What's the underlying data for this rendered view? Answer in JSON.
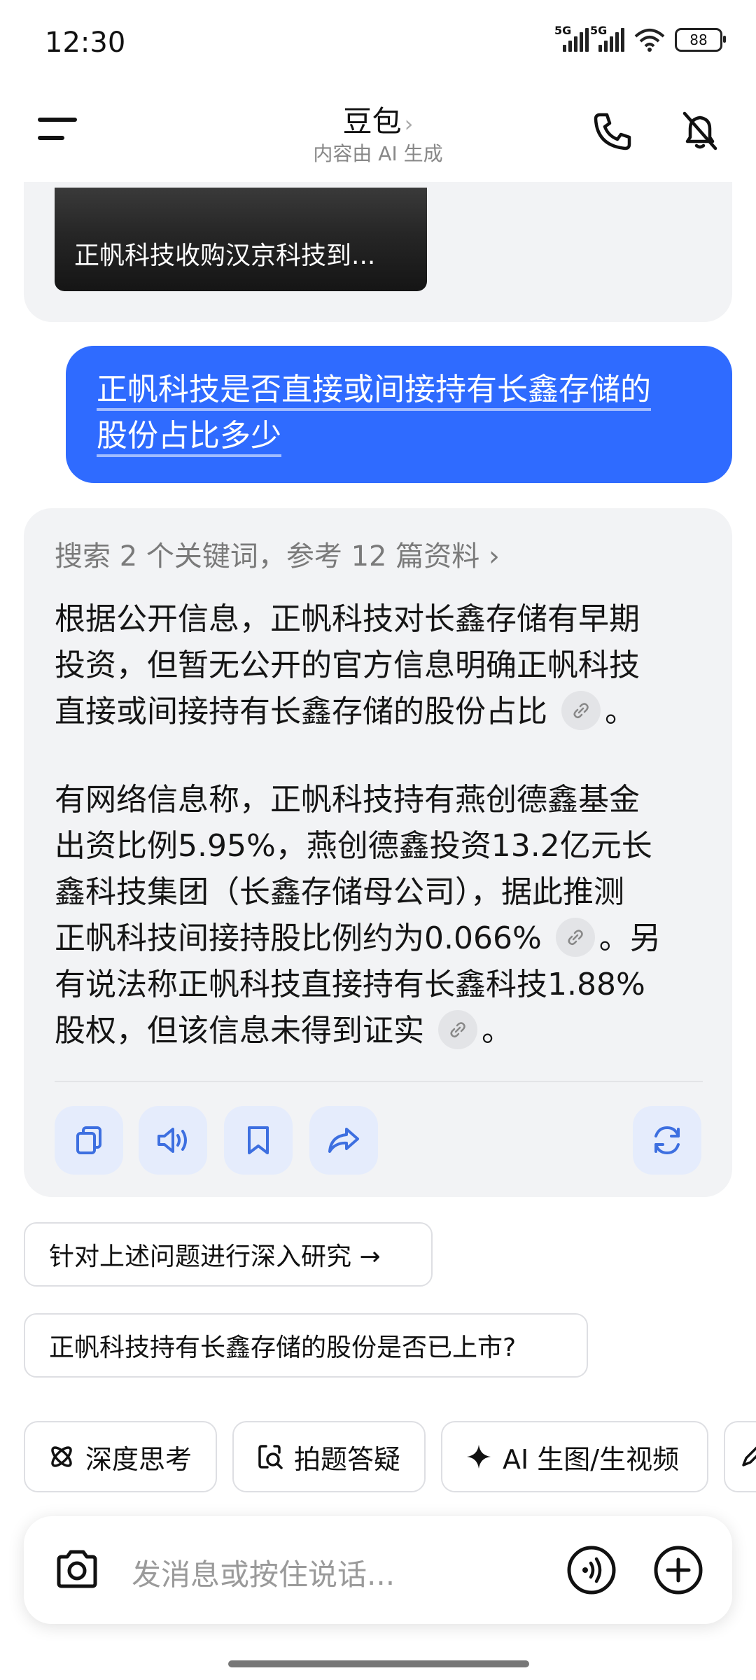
{
  "status_bar": {
    "time": "12:30",
    "network_1": "5G",
    "network_2": "5G",
    "battery": "88"
  },
  "header": {
    "title": "豆包",
    "title_chevron": "›",
    "subtitle": "内容由 AI 生成",
    "icons": [
      "menu-icon",
      "phone-icon",
      "mute-icon"
    ]
  },
  "previous_card": {
    "image_caption": "正帆科技收购汉京科技到..."
  },
  "user_message": {
    "line1": "正帆科技是否直接或间接持有长鑫存储的",
    "line2": "股份占比多少"
  },
  "answer": {
    "search_summary": "搜索 2 个关键词，参考 12 篇资料 ›",
    "para1": {
      "line1": "根据公开信息，正帆科技对长鑫存储有早期",
      "line2": "投资，但暂无公开的官方信息明确正帆科技",
      "line3": "直接或间接持有长鑫存储的股份占比",
      "line3_end": "。"
    },
    "para2": {
      "line1": "有网络信息称，正帆科技持有燕创德鑫基金",
      "line2": "出资比例5.95%，燕创德鑫投资13.2亿元长",
      "line3": "鑫科技集团（长鑫存储母公司），据此推测",
      "line4": "正帆科技间接持股比例约为0.066%",
      "line4_end": "。另",
      "line5": "有说法称正帆科技直接持有长鑫科技1.88%",
      "line6": "股权，但该信息未得到证实",
      "line6_end": "。"
    },
    "actions": [
      "copy-icon",
      "speaker-icon",
      "bookmark-icon",
      "share-icon",
      "regenerate-icon"
    ]
  },
  "suggestions": [
    "针对上述问题进行深入研究 →",
    "正帆科技持有长鑫存储的股份是否已上市?"
  ],
  "modes": [
    {
      "label": "深度思考",
      "icon": "atom-icon"
    },
    {
      "label": "拍题答疑",
      "icon": "scan-question-icon"
    },
    {
      "label": "AI 生图/生视频",
      "icon": "sparkle-icon"
    }
  ],
  "input": {
    "placeholder": "发消息或按住说话..."
  },
  "colors": {
    "accent": "#2f6bff",
    "card_bg": "#f2f3f5",
    "action_bg": "#e5ecfc"
  }
}
